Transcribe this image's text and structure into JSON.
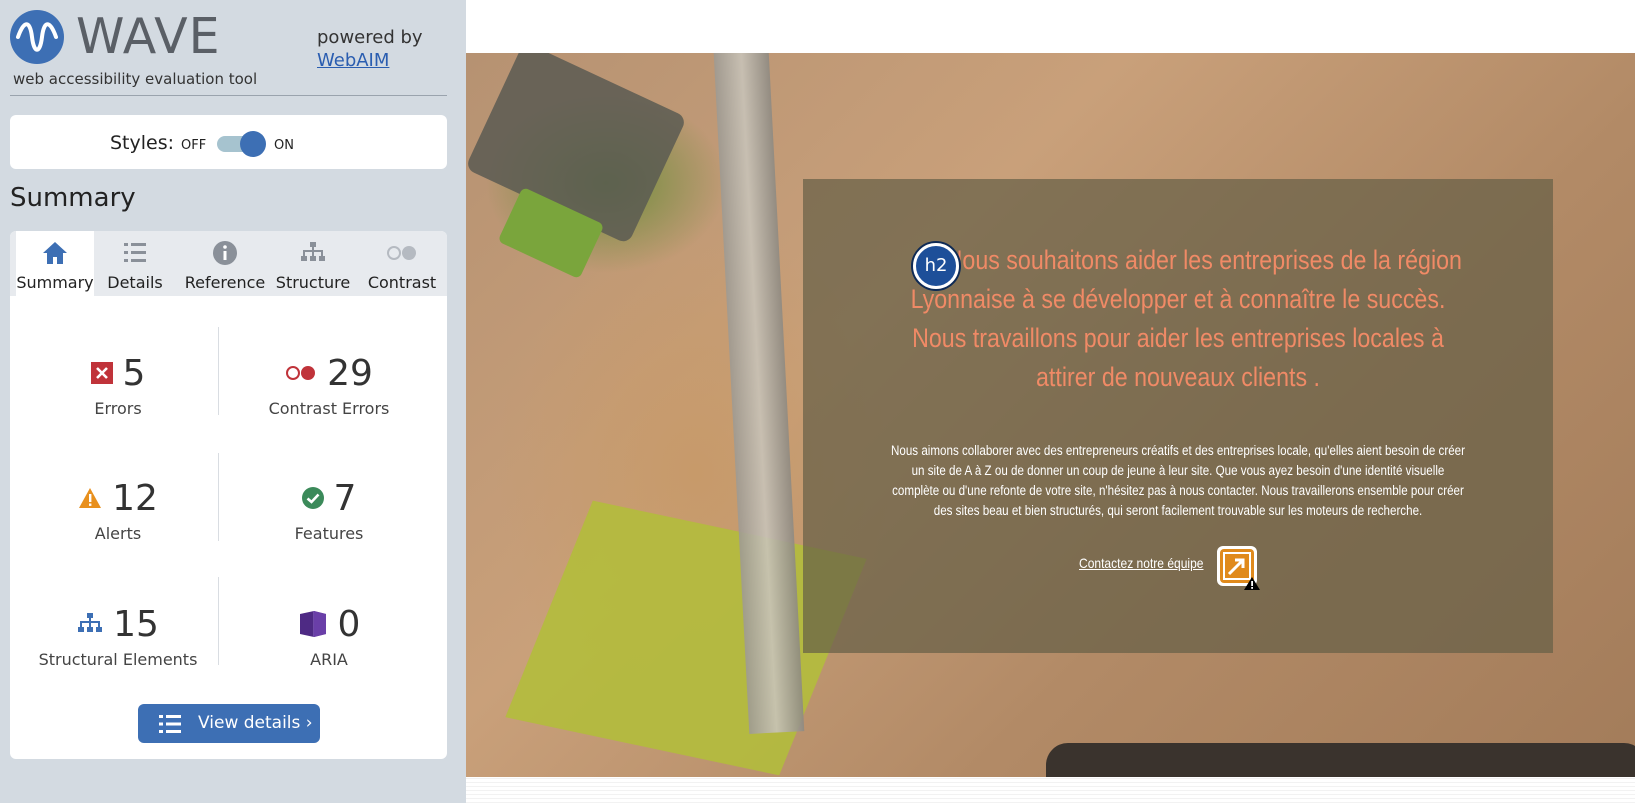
{
  "sidebar": {
    "logo": {
      "name": "WAVE",
      "tagline": "web accessibility evaluation tool"
    },
    "powered_by": {
      "label": "powered by",
      "link": "WebAIM"
    },
    "styles": {
      "label": "Styles:",
      "off": "OFF",
      "on": "ON",
      "state": "on"
    },
    "summary_heading": "Summary",
    "tabs": [
      {
        "label": "Summary",
        "icon": "home-icon",
        "active": true
      },
      {
        "label": "Details",
        "icon": "list-icon",
        "active": false
      },
      {
        "label": "Reference",
        "icon": "info-icon",
        "active": false
      },
      {
        "label": "Structure",
        "icon": "hierarchy-icon",
        "active": false
      },
      {
        "label": "Contrast",
        "icon": "contrast-icon",
        "active": false
      }
    ],
    "stats": {
      "errors": {
        "count": "5",
        "label": "Errors",
        "icon": "error-icon"
      },
      "contrast_errors": {
        "count": "29",
        "label": "Contrast Errors",
        "icon": "contrast-error-icon"
      },
      "alerts": {
        "count": "12",
        "label": "Alerts",
        "icon": "alert-icon"
      },
      "features": {
        "count": "7",
        "label": "Features",
        "icon": "feature-check-icon"
      },
      "structural": {
        "count": "15",
        "label": "Structural Elements",
        "icon": "structure-icon"
      },
      "aria": {
        "count": "0",
        "label": "ARIA",
        "icon": "aria-icon"
      }
    },
    "view_details": "View details ›"
  },
  "page": {
    "h2_badge": "h2",
    "heading_line1": "Nous souhaitons aider les entreprises de la région",
    "heading_rest": "Lyonnaise à se développer et à connaître le succès. Nous travaillons pour aider les entreprises locales à attirer de nouveaux clients .",
    "body": "Nous aimons collaborer avec des entrepreneurs créatifs et des entreprises locale, qu'elles aient besoin de créer un site de A à Z ou de donner un coup de jeune à leur site. Que vous ayez besoin d'une identité visuelle complète ou d'une refonte de votre site, n'hésitez pas à nous contacter. Nous travaillerons ensemble pour créer des sites beau et bien structurés, qui seront facilement trouvable sur les moteurs de recherche.",
    "contact_link": "Contactez notre équipe"
  },
  "colors": {
    "wave_blue": "#3d6fb4",
    "sidebar_bg": "#d3dae1",
    "error_red": "#c0333a",
    "alert_orange": "#e8901e",
    "feature_green": "#3b8a5a",
    "aria_purple": "#4e2a84",
    "heading_salmon": "#f08a66"
  }
}
